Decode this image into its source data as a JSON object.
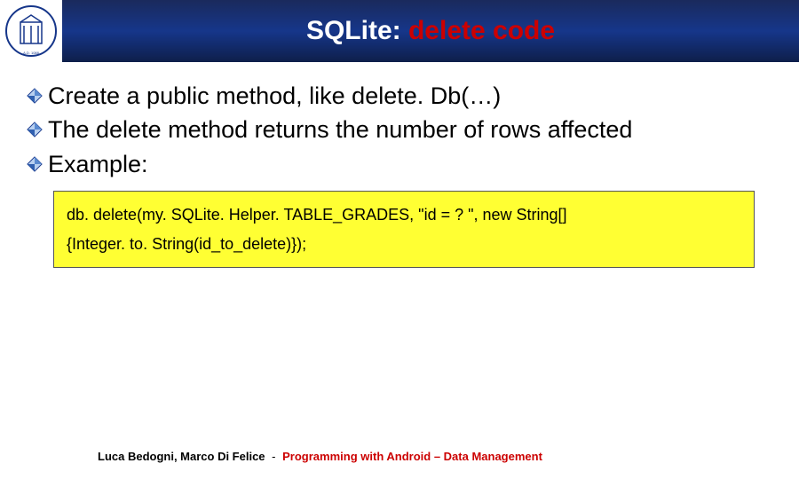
{
  "header": {
    "title_white": "SQLite: ",
    "title_red": "delete code"
  },
  "bullets": [
    "Create a public method, like delete. Db(…)",
    "The delete method returns the number of rows affected",
    "Example:"
  ],
  "code": {
    "line1": "db. delete(my. SQLite. Helper. TABLE_GRADES, \"id = ? \", new   String[]",
    "line2": "{Integer. to. String(id_to_delete)});"
  },
  "footer": {
    "authors": "Luca Bedogni, Marco Di Felice",
    "sep": "-",
    "course": "Programming with Android – Data Management"
  }
}
